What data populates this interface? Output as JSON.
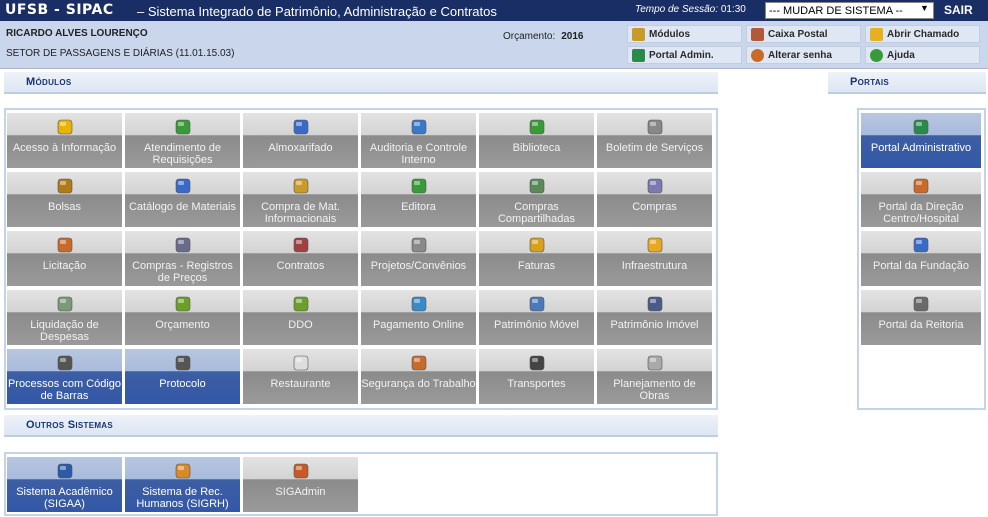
{
  "header": {
    "app_name": "UFSB - SIPAC",
    "app_desc": "– Sistema Integrado de Patrimônio, Administração e Contratos",
    "session_label": "Tempo de Sessão:",
    "session_time": "01:30",
    "system_select": "--- MUDAR DE SISTEMA --",
    "logout": "SAIR"
  },
  "user": {
    "name": "RICARDO ALVES LOURENÇO",
    "sector": "SETOR DE PASSAGENS E DIÁRIAS (11.01.15.03)",
    "budget_label": "Orçamento:",
    "budget_year": "2016"
  },
  "user_menu": [
    {
      "label": "Módulos",
      "icon": "modules-icon"
    },
    {
      "label": "Caixa Postal",
      "icon": "mailbox-icon"
    },
    {
      "label": "Abrir Chamado",
      "icon": "ticket-icon"
    },
    {
      "label": "Portal Admin.",
      "icon": "portal-admin-icon"
    },
    {
      "label": "Alterar senha",
      "icon": "password-icon"
    },
    {
      "label": "Ajuda",
      "icon": "help-icon"
    }
  ],
  "sections": {
    "modules": "Módulos",
    "portals": "Portais",
    "others": "Outros Sistemas"
  },
  "modules": [
    {
      "label": "Acesso à Informação",
      "icon": "info-icon",
      "color": "#e8b400"
    },
    {
      "label": "Atendimento de Requisições",
      "icon": "request-icon",
      "color": "#3a9a3a"
    },
    {
      "label": "Almoxarifado",
      "icon": "warehouse-icon",
      "color": "#3a6ac8"
    },
    {
      "label": "Auditoria e Controle Interno",
      "icon": "audit-icon",
      "color": "#3a78c8"
    },
    {
      "label": "Biblioteca",
      "icon": "library-icon",
      "color": "#3a9a3a"
    },
    {
      "label": "Boletim de Serviços",
      "icon": "bulletin-icon",
      "color": "#888888"
    },
    {
      "label": "Bolsas",
      "icon": "scholarship-icon",
      "color": "#b07a1a"
    },
    {
      "label": "Catálogo de Materiais",
      "icon": "catalog-icon",
      "color": "#3a6ac8"
    },
    {
      "label": "Compra de Mat. Informacionais",
      "icon": "books-purchase-icon",
      "color": "#c89a2a"
    },
    {
      "label": "Editora",
      "icon": "publisher-icon",
      "color": "#3a9a3a"
    },
    {
      "label": "Compras Compartilhadas",
      "icon": "shared-cart-icon",
      "color": "#5a8a5a"
    },
    {
      "label": "Compras",
      "icon": "cart-icon",
      "color": "#7a7ab0"
    },
    {
      "label": "Licitação",
      "icon": "bidding-icon",
      "color": "#c86a2a"
    },
    {
      "label": "Compras - Registros de Preços",
      "icon": "price-register-icon",
      "color": "#6a6a8a"
    },
    {
      "label": "Contratos",
      "icon": "contract-icon",
      "color": "#a04040"
    },
    {
      "label": "Projetos/Convênios",
      "icon": "projects-icon",
      "color": "#8a8a8a"
    },
    {
      "label": "Faturas",
      "icon": "invoice-icon",
      "color": "#d8a020"
    },
    {
      "label": "Infraestrutura",
      "icon": "infrastructure-icon",
      "color": "#e8a820"
    },
    {
      "label": "Liquidação de Despesas",
      "icon": "expense-icon",
      "color": "#7a9a7a"
    },
    {
      "label": "Orçamento",
      "icon": "budget-icon",
      "color": "#6aa02a"
    },
    {
      "label": "DDO",
      "icon": "ddo-icon",
      "color": "#6aa02a"
    },
    {
      "label": "Pagamento Online",
      "icon": "online-payment-icon",
      "color": "#3a8ac8"
    },
    {
      "label": "Patrimônio Móvel",
      "icon": "movable-assets-icon",
      "color": "#4a7ab8"
    },
    {
      "label": "Patrimônio Imóvel",
      "icon": "building-icon",
      "color": "#4a5a8a"
    },
    {
      "label": "Processos com Código de Barras",
      "icon": "barcode-icon",
      "color": "#555555",
      "active": true
    },
    {
      "label": "Protocolo",
      "icon": "protocol-icon",
      "color": "#555555",
      "active": true
    },
    {
      "label": "Restaurante",
      "icon": "restaurant-icon",
      "color": "#dddddd"
    },
    {
      "label": "Segurança do Trabalho",
      "icon": "safety-icon",
      "color": "#c86a2a"
    },
    {
      "label": "Transportes",
      "icon": "wheel-icon",
      "color": "#444444"
    },
    {
      "label": "Planejamento de Obras",
      "icon": "planning-icon",
      "color": "#aaaaaa"
    }
  ],
  "portals": [
    {
      "label": "Portal Administrativo",
      "icon": "portal-admin-icon",
      "color": "#2a8a4a",
      "active": true
    },
    {
      "label": "Portal da Direção Centro/Hospital",
      "icon": "direction-icon",
      "color": "#c86a2a"
    },
    {
      "label": "Portal da Fundação",
      "icon": "globe-icon",
      "color": "#3a6ac8"
    },
    {
      "label": "Portal da Reitoria",
      "icon": "rector-icon",
      "color": "#6a6a6a"
    }
  ],
  "other_systems": [
    {
      "label": "Sistema Acadêmico (SIGAA)",
      "icon": "academic-book-icon",
      "color": "#2a5aa8",
      "active": true
    },
    {
      "label": "Sistema de Rec. Humanos (SIGRH)",
      "icon": "person-icon",
      "color": "#d88a2a",
      "active": true
    },
    {
      "label": "SIGAdmin",
      "icon": "admin-users-icon",
      "color": "#c85a2a"
    }
  ]
}
